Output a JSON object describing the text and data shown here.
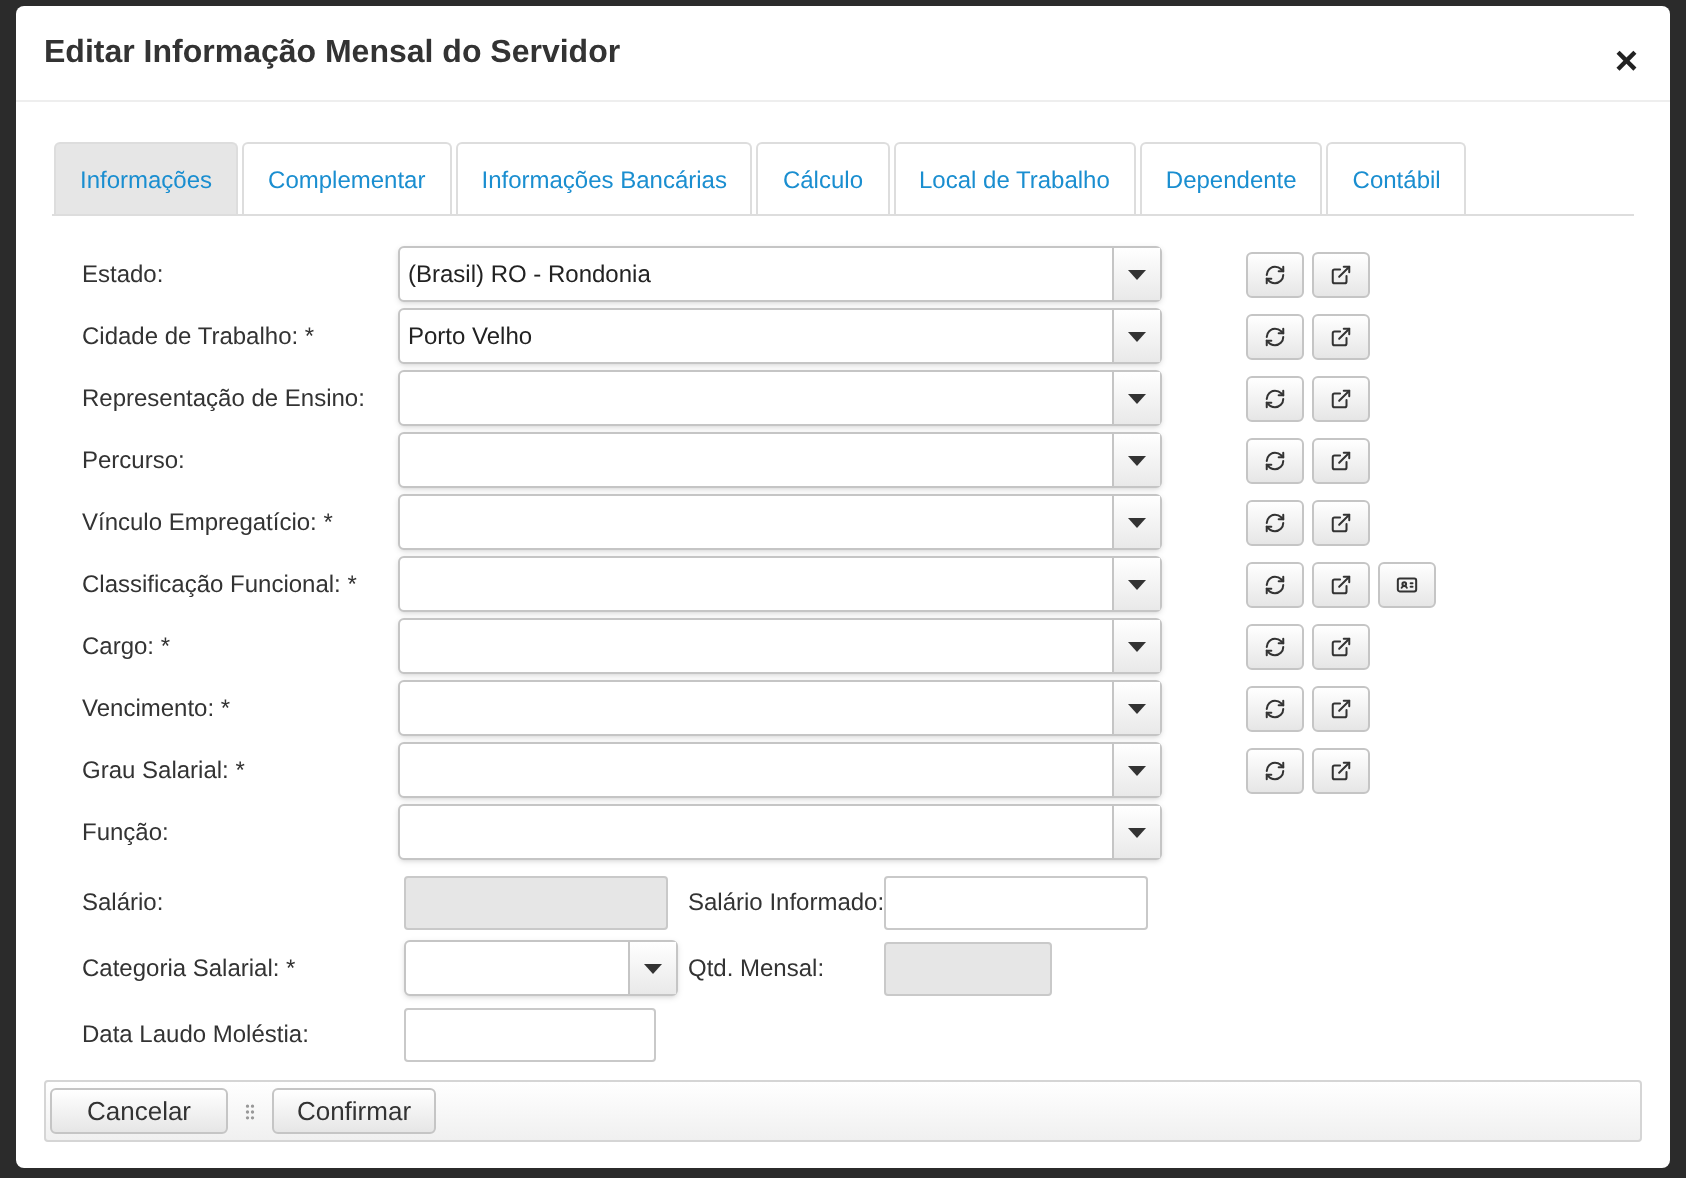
{
  "dialog": {
    "title": "Editar Informação Mensal do Servidor",
    "close": "×"
  },
  "tabs": [
    {
      "label": "Informações",
      "selected": true
    },
    {
      "label": "Complementar",
      "selected": false
    },
    {
      "label": "Informações Bancárias",
      "selected": false
    },
    {
      "label": "Cálculo",
      "selected": false
    },
    {
      "label": "Local de Trabalho",
      "selected": false
    },
    {
      "label": "Dependente",
      "selected": false
    },
    {
      "label": "Contábil",
      "selected": false
    }
  ],
  "select_fields": [
    {
      "label": "Estado:",
      "value": "(Brasil) RO - Rondonia",
      "actions": [
        {
          "kind": "refresh"
        },
        {
          "kind": "open"
        }
      ]
    },
    {
      "label": "Cidade de Trabalho: *",
      "value": "Porto Velho",
      "actions": [
        {
          "kind": "refresh"
        },
        {
          "kind": "open"
        }
      ]
    },
    {
      "label": "Representação de Ensino:",
      "actions": [
        {
          "kind": "refresh"
        },
        {
          "kind": "open"
        }
      ]
    },
    {
      "label": "Percurso:",
      "actions": [
        {
          "kind": "refresh"
        },
        {
          "kind": "open"
        }
      ]
    },
    {
      "label": "Vínculo Empregatício: *",
      "actions": [
        {
          "kind": "refresh"
        },
        {
          "kind": "open"
        }
      ]
    },
    {
      "label": "Classificação Funcional: *",
      "actions": [
        {
          "kind": "refresh"
        },
        {
          "kind": "open"
        },
        {
          "kind": "card"
        }
      ]
    },
    {
      "label": "Cargo: *",
      "actions": [
        {
          "kind": "refresh"
        },
        {
          "kind": "open"
        }
      ]
    },
    {
      "label": "Vencimento: *",
      "actions": [
        {
          "kind": "refresh"
        },
        {
          "kind": "open"
        }
      ]
    },
    {
      "label": "Grau Salarial: *",
      "actions": [
        {
          "kind": "refresh"
        },
        {
          "kind": "open"
        }
      ]
    },
    {
      "label": "Função:"
    }
  ],
  "small_rows": [
    {
      "label": "Salário:",
      "field": {
        "kind": "input",
        "disabled": true
      },
      "side": {
        "label": "Salário Informado:",
        "disabled": false
      }
    },
    {
      "label": "Categoria Salarial: *",
      "field": {
        "kind": "select"
      },
      "side": {
        "label": "Qtd. Mensal:",
        "disabled": true
      }
    },
    {
      "label": "Data Laudo Moléstia:",
      "field": {
        "kind": "input",
        "disabled": false
      }
    }
  ],
  "footer": {
    "buttons": [
      "Cancelar",
      "Confirmar"
    ]
  }
}
